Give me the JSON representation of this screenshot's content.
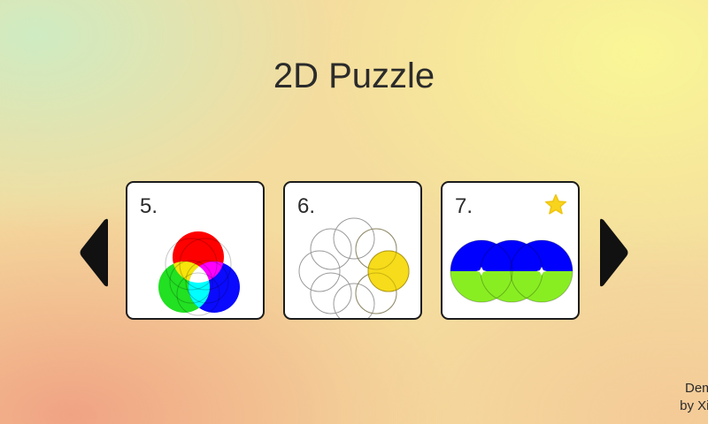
{
  "title": "2D Puzzle",
  "levels": [
    {
      "number": "5.",
      "starred": false
    },
    {
      "number": "6.",
      "starred": false
    },
    {
      "number": "7.",
      "starred": true
    }
  ],
  "colors": {
    "red": "#ff0000",
    "green": "#22e022",
    "blue": "#0a0aff",
    "yellow": "#f6dc1a",
    "lime": "#88ee22",
    "star": "#f8d41c"
  },
  "navigation": {
    "prev_icon": "triangle-left-icon",
    "next_icon": "triangle-right-icon"
  },
  "credit": {
    "line1": "Demo",
    "line2": "by Xi L"
  }
}
